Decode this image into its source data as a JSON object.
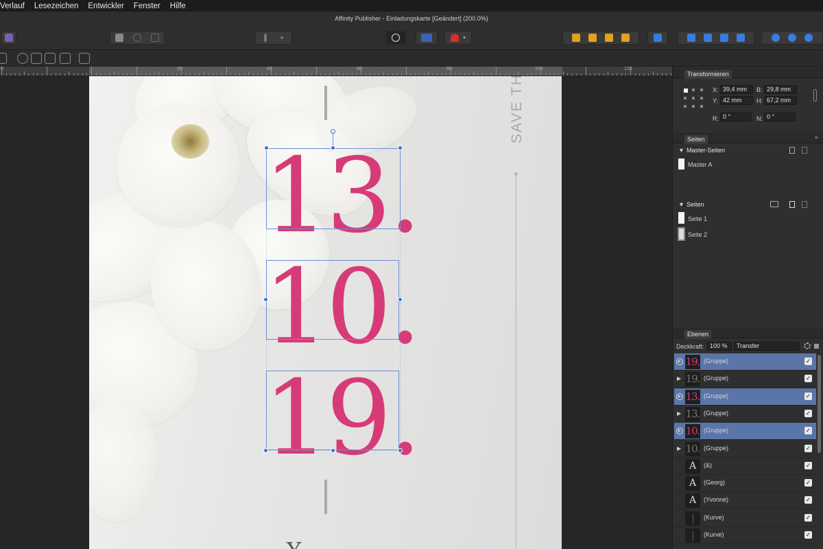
{
  "menu": [
    "Verlauf",
    "Lesezeichen",
    "Entwickler",
    "Fenster",
    "Hilfe"
  ],
  "window_title": "Affinity Publisher - Einladungskarte [Geändert] (200.0%)",
  "ruler_labels": [
    "0",
    "20",
    "40",
    "60",
    "80",
    "100",
    "120"
  ],
  "document": {
    "dates": [
      "13.",
      "10.",
      "19."
    ],
    "vertical_text": "SAVE TH",
    "bottom_text": "Y"
  },
  "transform": {
    "tab": "Transformieren",
    "x_label": "X:",
    "x": "39,4 mm",
    "y_label": "Y:",
    "y": "42 mm",
    "b_label": "B:",
    "b": "29,8 mm",
    "h_label": "H:",
    "h": "67,2 mm",
    "r_label": "R:",
    "r": "0 °",
    "n_label": "N:",
    "n": "0 °"
  },
  "pages_panel": {
    "tab": "Seiten",
    "master_header": "Master-Seiten",
    "masters": [
      "Master A"
    ],
    "pages_header": "Seiten",
    "pages": [
      "Seite 1",
      "Seite 2"
    ]
  },
  "layers_panel": {
    "tab": "Ebenen",
    "opacity_label": "Deckkraft:",
    "opacity": "100 %",
    "blend": "Transfer",
    "rows": [
      {
        "thumb": "19.",
        "name": "(Gruppe)",
        "selected": true,
        "thumb_color": "#d63b78"
      },
      {
        "thumb": "19.",
        "name": "(Gruppe)",
        "selected": false,
        "thumb_color": "#777777"
      },
      {
        "thumb": "13.",
        "name": "(Gruppe)",
        "selected": true,
        "thumb_color": "#d63b78"
      },
      {
        "thumb": "13.",
        "name": "(Gruppe)",
        "selected": false,
        "thumb_color": "#777777"
      },
      {
        "thumb": "10.",
        "name": "(Gruppe)",
        "selected": true,
        "thumb_color": "#d63b78"
      },
      {
        "thumb": "10.",
        "name": "(Gruppe)",
        "selected": false,
        "thumb_color": "#777777"
      },
      {
        "thumb": "A",
        "name": "(&)",
        "selected": false,
        "thumb_color": "#dddddd"
      },
      {
        "thumb": "A",
        "name": "(Georg)",
        "selected": false,
        "thumb_color": "#dddddd"
      },
      {
        "thumb": "A",
        "name": "(Yvonne)",
        "selected": false,
        "thumb_color": "#dddddd"
      },
      {
        "thumb": "|",
        "name": "(Kurve)",
        "selected": false,
        "thumb_color": "#555555"
      },
      {
        "thumb": "|",
        "name": "(Kurve)",
        "selected": false,
        "thumb_color": "#555555"
      }
    ]
  },
  "colors": {
    "accent_pink": "#d63b78",
    "selection_blue": "#3a73d8",
    "layer_selected": "#5a75a8"
  }
}
